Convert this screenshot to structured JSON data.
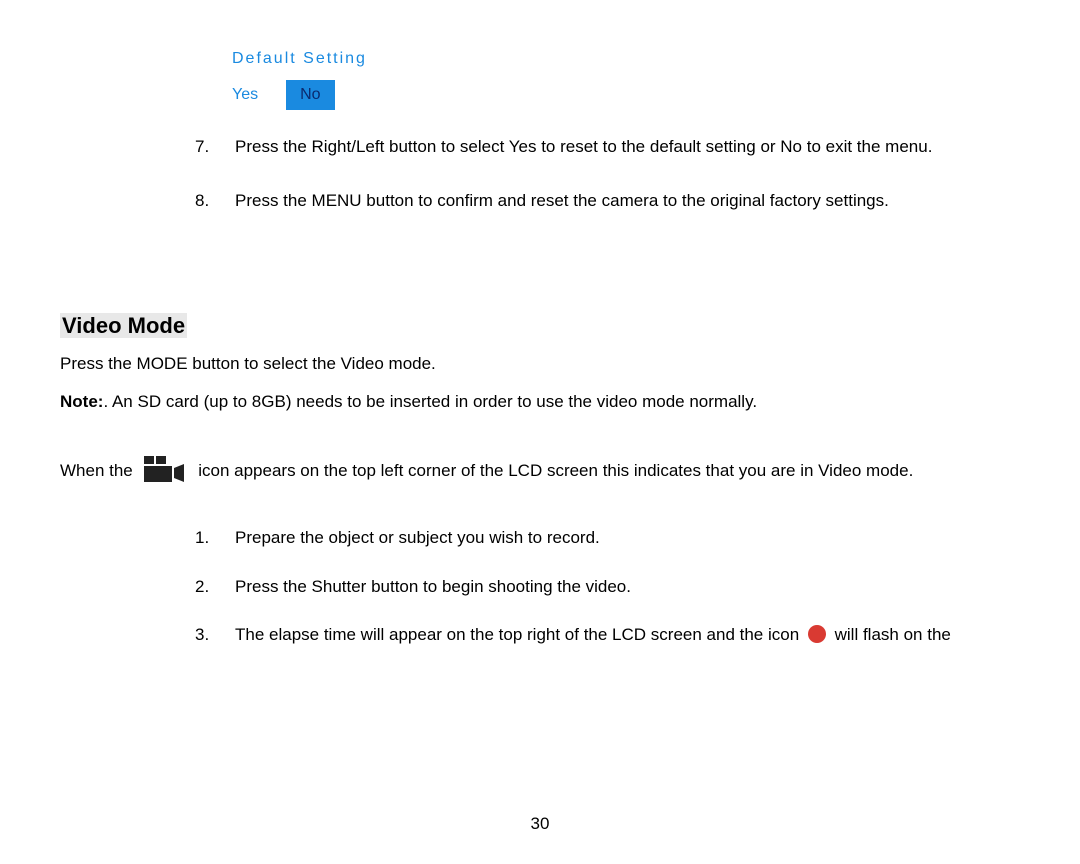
{
  "menuBox": {
    "title": "Default Setting",
    "yes": "Yes",
    "no": "No"
  },
  "instructions": {
    "item7": {
      "num": "7.",
      "text": "Press the Right/Left button to select Yes to reset to the default setting or No to exit the menu."
    },
    "item8": {
      "num": "8.",
      "text": "Press the MENU button to confirm and reset the camera to the original factory settings."
    }
  },
  "section": {
    "heading": "Video Mode",
    "intro": "Press the MODE button to select the Video mode.",
    "noteLabel": "Note:",
    "noteText": ". An SD card (up to 8GB) needs to be inserted in order to use the video mode normally.",
    "whenPart1": "When the ",
    "whenPart2": " icon appears on the top left corner of the LCD screen this indicates that you are in Video mode."
  },
  "steps": {
    "s1": {
      "num": "1.",
      "text": "Prepare the object or subject you wish to record."
    },
    "s2": {
      "num": "2.",
      "text": "Press the Shutter button to begin shooting the video."
    },
    "s3": {
      "num": "3.",
      "textA": "The elapse time will appear on the top right of the LCD screen and the icon ",
      "textB": " will flash on the"
    }
  },
  "pageNumber": "30"
}
